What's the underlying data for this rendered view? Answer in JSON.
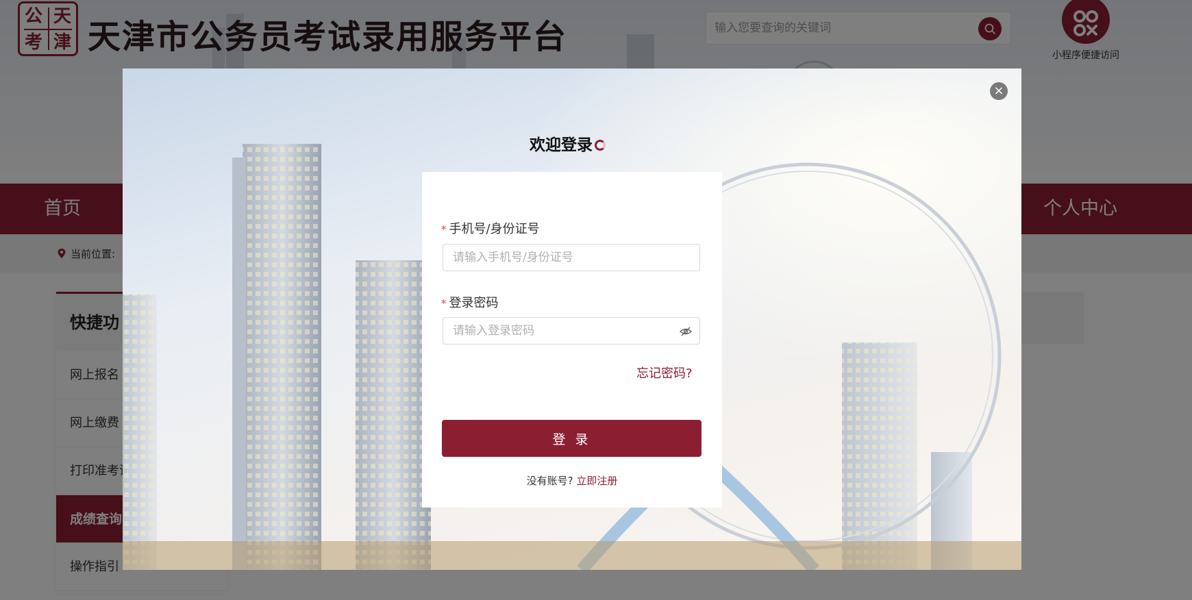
{
  "header": {
    "site_title": "天津市公务员考试录用服务平台",
    "logo_chars": [
      "公",
      "天",
      "考",
      "津"
    ],
    "search_placeholder": "输入您要查询的关键词",
    "mini_program_label": "小程序便捷访问"
  },
  "nav": {
    "items": [
      "首页",
      "个人中心"
    ]
  },
  "breadcrumb": {
    "label": "当前位置:"
  },
  "sidebar": {
    "heading": "快捷功",
    "items": [
      "网上报名",
      "网上缴费",
      "打印准考证",
      "成绩查询",
      "操作指引"
    ],
    "active_index": 3
  },
  "login_modal": {
    "title": "欢迎登录",
    "close_symbol": "×",
    "account_label": "手机号/身份证号",
    "account_placeholder": "请输入手机号/身份证号",
    "password_label": "登录密码",
    "password_placeholder": "请输入登录密码",
    "required_mark": "*",
    "forgot_password": "忘记密码?",
    "login_button": "登 录",
    "no_account_text": "没有账号?",
    "register_link": "立即注册"
  },
  "colors": {
    "brand": "#8c1e32",
    "required": "#e53d3d"
  }
}
